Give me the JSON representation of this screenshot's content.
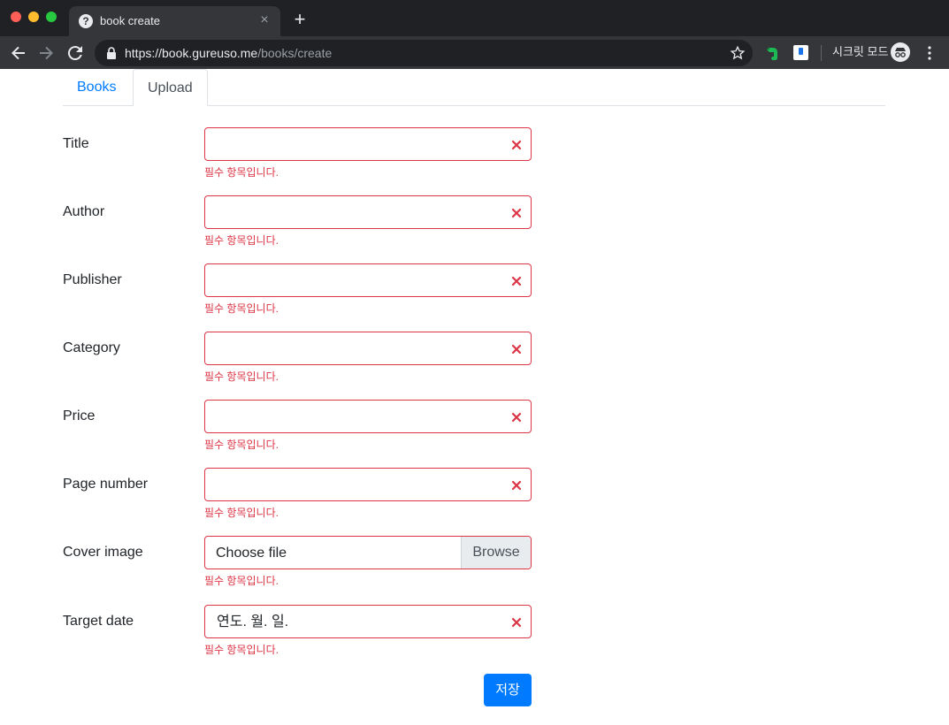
{
  "browser": {
    "tab_title": "book create",
    "url_host": "https://book.gureuso.me",
    "url_path": "/books/create",
    "incognito_label": "시크릿 모드"
  },
  "tabs": [
    {
      "label": "Books",
      "active": false
    },
    {
      "label": "Upload",
      "active": true
    }
  ],
  "form": {
    "fields": [
      {
        "label": "Title",
        "value": "",
        "error": "필수 항목입니다."
      },
      {
        "label": "Author",
        "value": "",
        "error": "필수 항목입니다."
      },
      {
        "label": "Publisher",
        "value": "",
        "error": "필수 항목입니다."
      },
      {
        "label": "Category",
        "value": "",
        "error": "필수 항목입니다."
      },
      {
        "label": "Price",
        "value": "",
        "error": "필수 항목입니다."
      },
      {
        "label": "Page number",
        "value": "",
        "error": "필수 항목입니다."
      },
      {
        "label": "Cover image",
        "file_placeholder": "Choose file",
        "browse_label": "Browse",
        "error": "필수 항목입니다."
      },
      {
        "label": "Target date",
        "value": "연도. 월. 일.",
        "error": "필수 항목입니다."
      }
    ],
    "submit_label": "저장"
  },
  "colors": {
    "invalid": "#dc3545",
    "primary": "#007bff",
    "chrome_dark": "#202124",
    "chrome_toolbar": "#35363a"
  }
}
